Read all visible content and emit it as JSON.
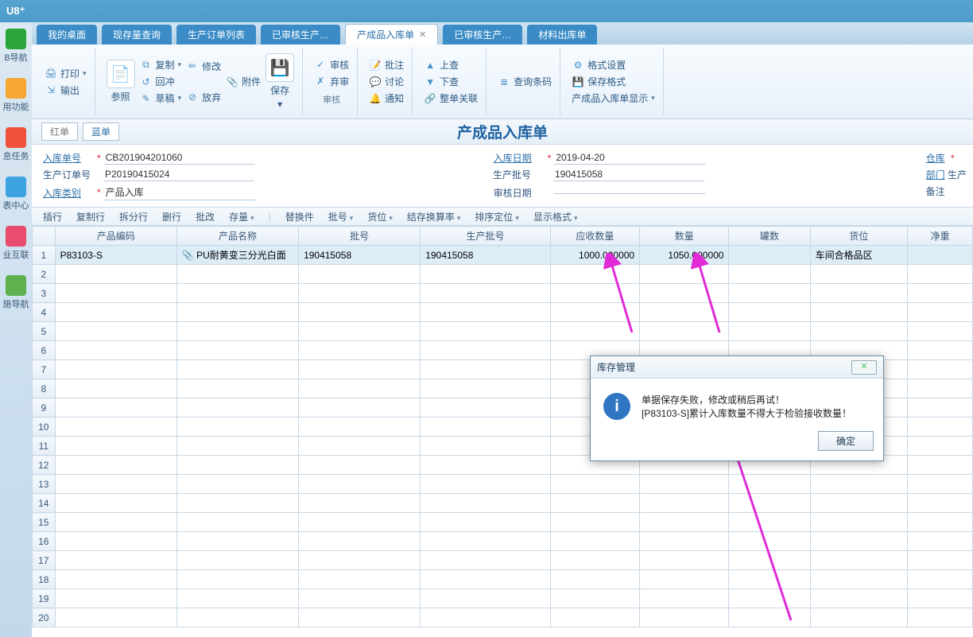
{
  "app": {
    "brand": "U8⁺"
  },
  "sidebar": [
    {
      "icon": "ic-home",
      "label": "B导航"
    },
    {
      "icon": "ic-star",
      "label": "用功能"
    },
    {
      "icon": "ic-mail",
      "label": "息任务"
    },
    {
      "icon": "ic-chart",
      "label": "表中心"
    },
    {
      "icon": "ic-net",
      "label": "业互联"
    },
    {
      "icon": "ic-leaf",
      "label": "施导航"
    }
  ],
  "tabs": [
    {
      "label": "我的桌面"
    },
    {
      "label": "现存量查询"
    },
    {
      "label": "生产订单列表"
    },
    {
      "label": "已审核生产…"
    },
    {
      "label": "产成品入库单",
      "active": true,
      "closable": true
    },
    {
      "label": "已审核生产…"
    },
    {
      "label": "材料出库单"
    }
  ],
  "ribbon": {
    "print": "打印",
    "output": "输出",
    "ref": "参照",
    "copy": "复制",
    "hedge": "回冲",
    "draft": "草稿",
    "modify": "修改",
    "attach": "附件",
    "abandon": "放弃",
    "save": "保存",
    "audit": "审核",
    "unaudit": "弃审",
    "batch_audit": "批注",
    "discuss": "讨论",
    "notify": "通知",
    "prev": "上查",
    "next": "下查",
    "whole": "整单关联",
    "query_barcode": "查询条码",
    "format_set": "格式设置",
    "save_format": "保存格式",
    "display_set": "产成品入库单显示"
  },
  "subtabs": {
    "red": "红单",
    "blue": "蓝单"
  },
  "doc_title": "产成品入库单",
  "form": {
    "in_no_label": "入库单号",
    "in_no": "CB201904201060",
    "order_label": "生产订单号",
    "order": "P20190415024",
    "type_label": "入库类别",
    "type": "产品入库",
    "date_label": "入库日期",
    "date": "2019-04-20",
    "batch_label": "生产批号",
    "batch": "190415058",
    "audit_date_label": "审核日期",
    "audit_date": "",
    "warehouse_label": "仓库",
    "dept_label": "部门",
    "dept_side": "生产",
    "memo_label": "备注"
  },
  "grid_toolbar": [
    "插行",
    "复制行",
    "拆分行",
    "删行",
    "批改",
    "存量",
    "替换件",
    "批号",
    "货位",
    "结存换算率",
    "排序定位",
    "显示格式"
  ],
  "grid": {
    "columns": [
      "产品编码",
      "产品名称",
      "批号",
      "生产批号",
      "应收数量",
      "数量",
      "罐数",
      "货位",
      "净重"
    ],
    "rows": [
      {
        "code": "P83103-S",
        "name": "PU耐黄变三分光白面",
        "lot": "190415058",
        "prod_lot": "190415058",
        "recv_qty": "1000.000000",
        "qty": "1050.000000",
        "cans": "",
        "loc": "车间合格品区",
        "net": ""
      }
    ],
    "row_count": 20
  },
  "dialog": {
    "title": "库存管理",
    "line1": "单据保存失败，修改或稍后再试！",
    "line2": "[P83103-S]累计入库数量不得大于检验接收数量！",
    "ok": "确定"
  }
}
